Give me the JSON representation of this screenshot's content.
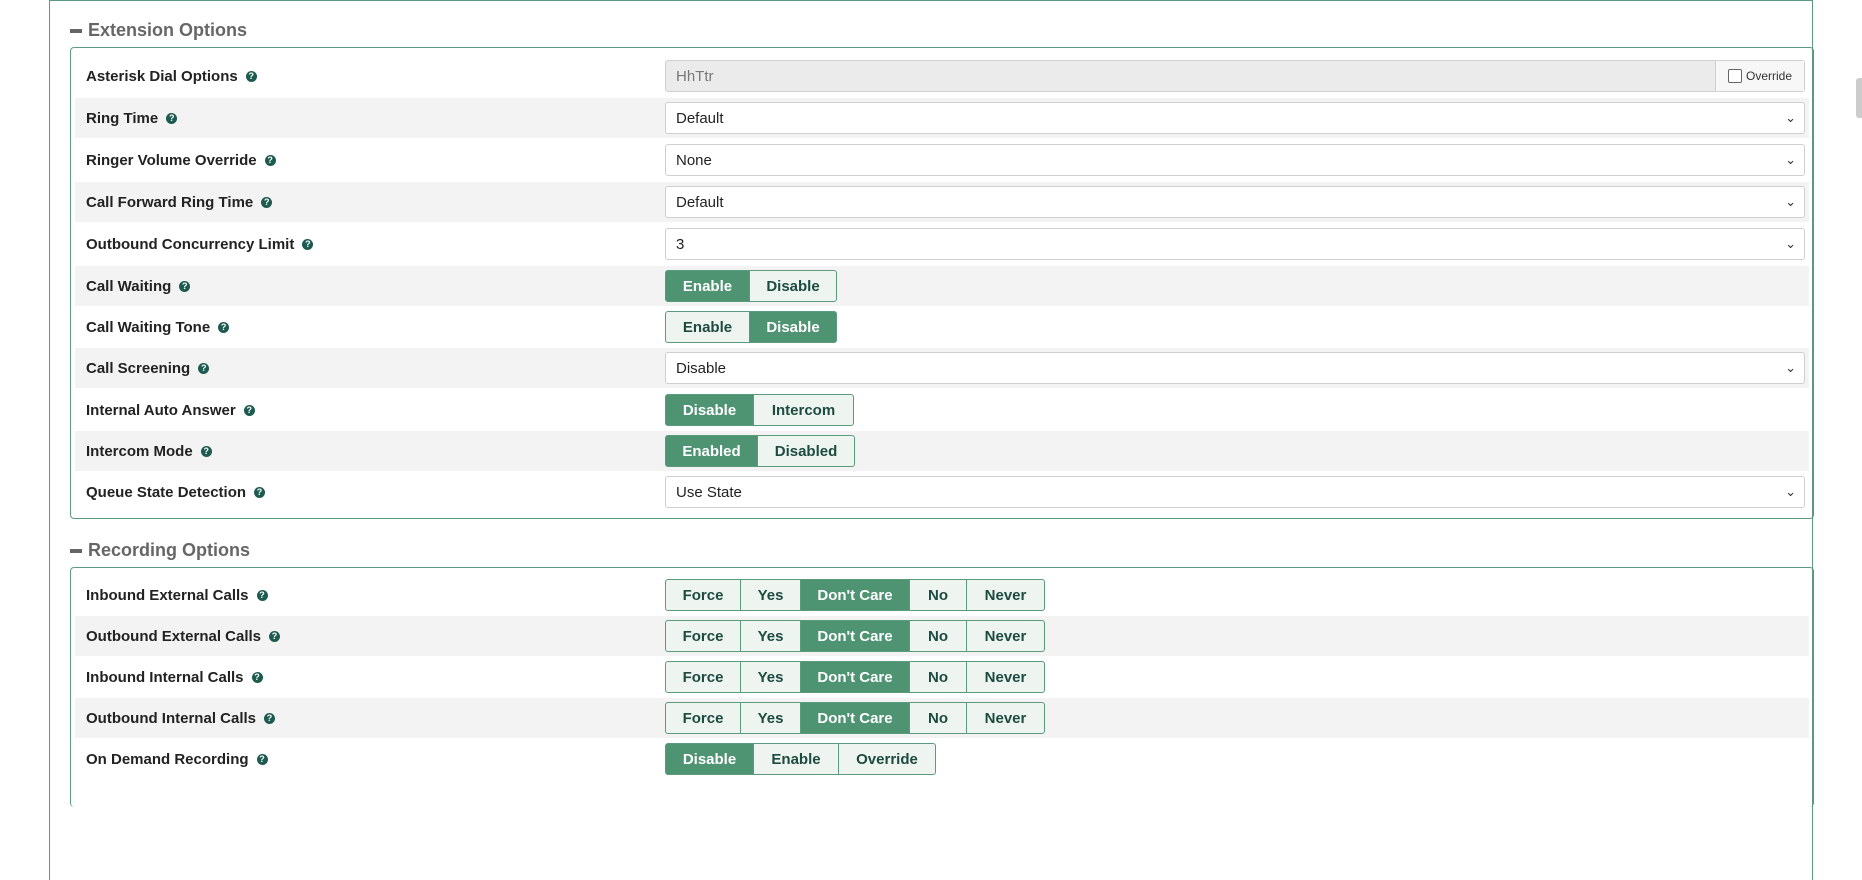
{
  "extension_section": {
    "title": "Extension Options",
    "rows": [
      {
        "label": "Asterisk Dial Options",
        "type": "text",
        "value": "HhTtr",
        "override_label": "Override"
      },
      {
        "label": "Ring Time",
        "type": "select",
        "value": "Default"
      },
      {
        "label": "Ringer Volume Override",
        "type": "select",
        "value": "None"
      },
      {
        "label": "Call Forward Ring Time",
        "type": "select",
        "value": "Default"
      },
      {
        "label": "Outbound Concurrency Limit",
        "type": "select",
        "value": "3"
      },
      {
        "label": "Call Waiting",
        "type": "buttons",
        "options": [
          "Enable",
          "Disable"
        ],
        "active": 0
      },
      {
        "label": "Call Waiting Tone",
        "type": "buttons",
        "options": [
          "Enable",
          "Disable"
        ],
        "active": 1
      },
      {
        "label": "Call Screening",
        "type": "select",
        "value": "Disable"
      },
      {
        "label": "Internal Auto Answer",
        "type": "buttons",
        "options": [
          "Disable",
          "Intercom"
        ],
        "active": 0
      },
      {
        "label": "Intercom Mode",
        "type": "buttons",
        "options": [
          "Enabled",
          "Disabled"
        ],
        "active": 0
      },
      {
        "label": "Queue State Detection",
        "type": "select",
        "value": "Use State"
      }
    ]
  },
  "recording_section": {
    "title": "Recording Options",
    "rows": [
      {
        "label": "Inbound External Calls",
        "type": "buttons",
        "options": [
          "Force",
          "Yes",
          "Don't Care",
          "No",
          "Never"
        ],
        "active": 2
      },
      {
        "label": "Outbound External Calls",
        "type": "buttons",
        "options": [
          "Force",
          "Yes",
          "Don't Care",
          "No",
          "Never"
        ],
        "active": 2
      },
      {
        "label": "Inbound Internal Calls",
        "type": "buttons",
        "options": [
          "Force",
          "Yes",
          "Don't Care",
          "No",
          "Never"
        ],
        "active": 2
      },
      {
        "label": "Outbound Internal Calls",
        "type": "buttons",
        "options": [
          "Force",
          "Yes",
          "Don't Care",
          "No",
          "Never"
        ],
        "active": 2
      },
      {
        "label": "On Demand Recording",
        "type": "buttons",
        "options": [
          "Disable",
          "Enable",
          "Override"
        ],
        "active": 0
      }
    ]
  },
  "icons": {
    "help": "question-circle-icon",
    "collapse": "minus-icon",
    "dropdown": "chevron-down-icon"
  },
  "colors": {
    "accent": "#4e9472",
    "border": "#5a9b7d",
    "help_icon": "#1d5a4f"
  }
}
